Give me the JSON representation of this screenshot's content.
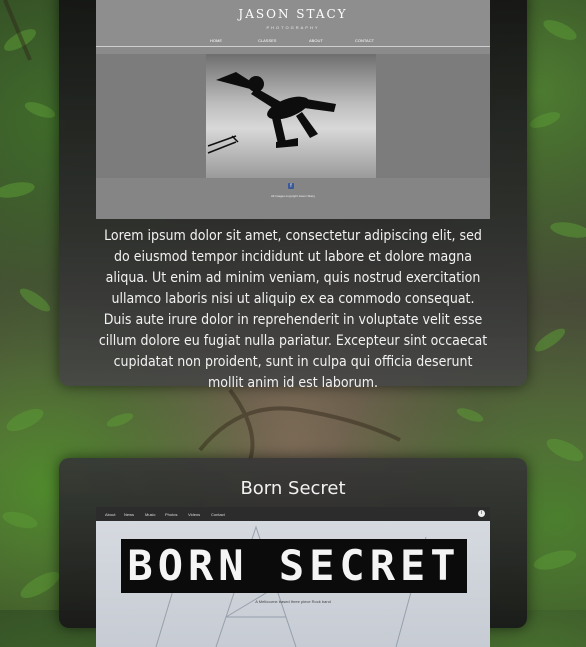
{
  "card1": {
    "thumbnail": {
      "site_title": "JASON STACY",
      "site_subtitle": "PHOTOGRAPHY",
      "nav": [
        "HOME",
        "CLASSES",
        "ABOUT",
        "CONTACT"
      ],
      "facebook_glyph": "f",
      "copyright": "All images copyright Jason Stacy"
    },
    "body_text": "Lorem ipsum dolor sit amet, consectetur adipiscing elit, sed do eiusmod tempor incididunt ut labore et dolore magna aliqua. Ut enim ad minim veniam, quis nostrud exercitation ullamco laboris nisi ut aliquip ex ea commodo consequat. Duis aute irure dolor in reprehenderit in voluptate velit esse cillum dolore eu fugiat nulla pariatur. Excepteur sint occaecat cupidatat non proident, sunt in culpa qui officia deserunt mollit anim id est laborum."
  },
  "card2": {
    "title": "Born Secret",
    "thumbnail": {
      "nav": [
        "About",
        "News",
        "Music",
        "Photos",
        "Videos",
        "Contact"
      ],
      "info_glyph": "i",
      "banner": "BORN SECRET",
      "tagline": "A Melbourne based three piece Rock band"
    }
  },
  "colors": {
    "card_bg": "#2a2a2a",
    "text": "#f2f2f2",
    "foliage": "#4a7d2e",
    "facebook": "#3b5998"
  },
  "icons": [
    "facebook-icon",
    "info-icon"
  ]
}
